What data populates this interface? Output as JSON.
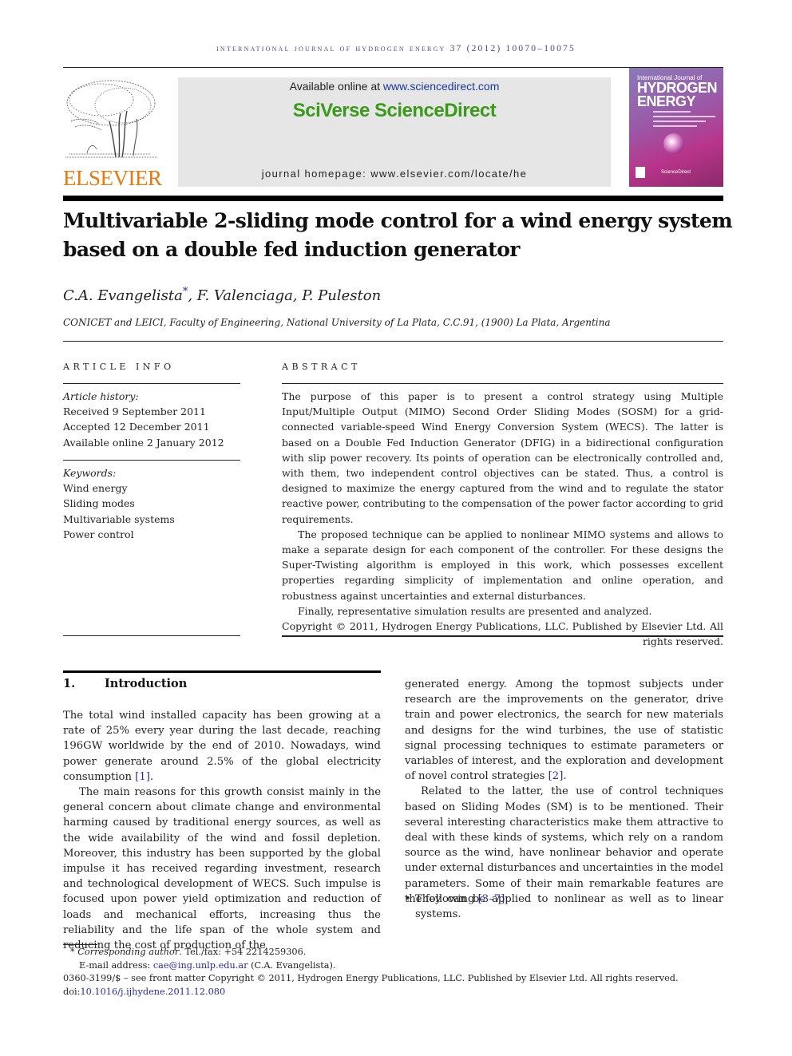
{
  "journal": {
    "running_head": "INTERNATIONAL JOURNAL OF HYDROGEN ENERGY 37 (2012) 10070–10075",
    "publisher_logo_text": "ELSEVIER",
    "available_online_prefix": "Available online at ",
    "available_online_link": "www.sciencedirect.com",
    "brand": "SciVerse ScienceDirect",
    "homepage": "journal homepage: www.elsevier.com/locate/he",
    "cover": {
      "line1": "International Journal of",
      "line2": "HYDROGEN",
      "line3": "ENERGY",
      "footer": "ScienceDirect"
    }
  },
  "article": {
    "title": "Multivariable 2-sliding mode control for a wind energy system based on a double fed induction generator",
    "authors": {
      "first": "C.A. Evangelista",
      "first_mark": "*",
      "rest": ", F. Valenciaga, P. Puleston"
    },
    "affiliation": "CONICET and LEICI, Faculty of Engineering, National University of La Plata, C.C.91, (1900) La Plata, Argentina"
  },
  "article_info": {
    "label": "ARTICLE INFO",
    "history_label": "Article history:",
    "history": [
      "Received 9 September 2011",
      "Accepted 12 December 2011",
      "Available online 2 January 2012"
    ],
    "keywords_label": "Keywords:",
    "keywords": [
      "Wind energy",
      "Sliding modes",
      "Multivariable systems",
      "Power control"
    ]
  },
  "abstract": {
    "label": "ABSTRACT",
    "paragraphs": [
      "The purpose of this paper is to present a control strategy using Multiple Input/Multiple Output (MIMO) Second Order Sliding Modes (SOSM) for a grid-connected variable-speed Wind Energy Conversion System (WECS). The latter is based on a Double Fed Induction Generator (DFIG) in a bidirectional configuration with slip power recovery. Its points of operation can be electronically controlled and, with them, two independent control objectives can be stated. Thus, a control is designed to maximize the energy captured from the wind and to regulate the stator reactive power, contributing to the compensation of the power factor according to grid requirements.",
      "The proposed technique can be applied to nonlinear MIMO systems and allows to make a separate design for each component of the controller. For these designs the Super-Twisting algorithm is employed in this work, which possesses excellent properties regarding simplicity of implementation and online operation, and robustness against uncertainties and external disturbances.",
      "Finally, representative simulation results are presented and analyzed."
    ],
    "copyright": "Copyright © 2011, Hydrogen Energy Publications, LLC. Published by Elsevier Ltd. All rights reserved."
  },
  "introduction": {
    "number": "1.",
    "heading": "Introduction",
    "left": {
      "p1": "The total wind installed capacity has been growing at a rate of 25% every year during the last decade, reaching 196GW worldwide by the end of 2010. Nowadays, wind power generate around 2.5% of the global electricity consumption ",
      "p1_ref": "[1]",
      "p1_end": ".",
      "p2": "The main reasons for this growth consist mainly in the general concern about climate change and environmental harming caused by traditional energy sources, as well as the wide availability of the wind and fossil depletion. Moreover, this industry has been supported by the global impulse it has received regarding investment, research and technological development of WECS. Such impulse is focused upon power yield optimization and reduction of loads and mechanical efforts, increasing thus the reliability and the life span of the whole system and reducing the cost of production of the"
    },
    "right": {
      "p1": "generated energy. Among the topmost subjects under research are the improvements on the generator, drive train and power electronics, the search for new materials and designs for the wind turbines, the use of statistic signal processing techniques to estimate parameters or variables of interest, and the exploration and development of novel control strategies ",
      "p1_ref": "[2]",
      "p1_end": ".",
      "p2": "Related to the latter, the use of control techniques based on Sliding Modes (SM) is to be mentioned. Their several interesting characteristics make them attractive to deal with these kinds of systems, which rely on a random source as the wind, have nonlinear behavior and operate under external disturbances and uncertainties in the model parameters. Some of their main remarkable features are the following ",
      "p2_ref": "[3–7]",
      "p2_end": ":",
      "bullets": [
        "They can be applied to nonlinear as well as to linear systems."
      ]
    }
  },
  "footnotes": {
    "mark": "*",
    "corresponding_label": "Corresponding author",
    "corresponding_rest": ". Tel./fax: +54 2214259306.",
    "email_label": "E-mail address: ",
    "email": "cae@ing.unlp.edu.ar",
    "email_rest": " (C.A. Evangelista).",
    "issn_line": "0360-3199/$ – see front matter Copyright © 2011, Hydrogen Energy Publications, LLC. Published by Elsevier Ltd. All rights reserved.",
    "doi_prefix": "doi:",
    "doi": "10.1016/j.ijhydene.2011.12.080"
  },
  "colors": {
    "brand_green": "#3a9a1a",
    "elsevier_orange": "#e8790f",
    "link_blue": "#2a2a9a",
    "running_head": "#4a4a8a"
  }
}
